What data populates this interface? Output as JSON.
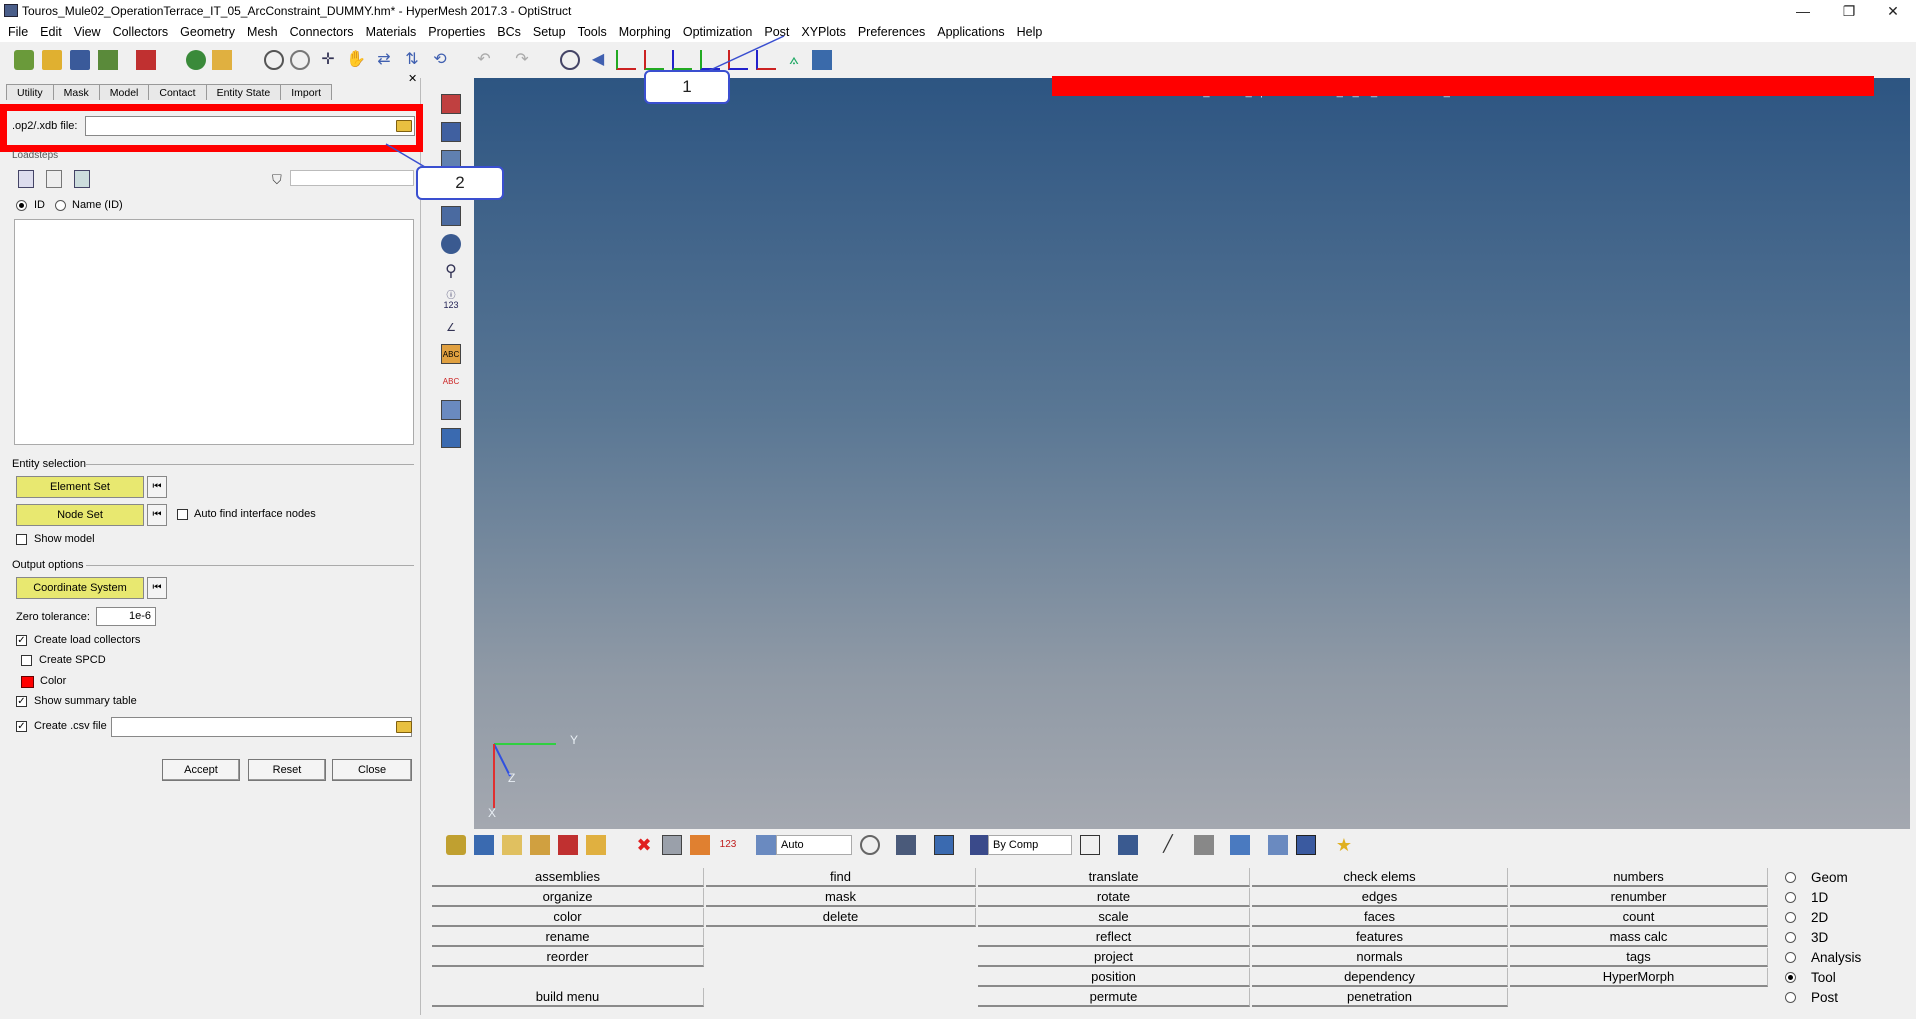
{
  "window": {
    "title": "Touros_Mule02_OperationTerrace_IT_05_ArcConstraint_DUMMY.hm* - HyperMesh 2017.3 - OptiStruct",
    "minimize": "—",
    "restore": "❐",
    "close": "✕"
  },
  "menu": [
    "File",
    "Edit",
    "View",
    "Collectors",
    "Geometry",
    "Mesh",
    "Connectors",
    "Materials",
    "Properties",
    "BCs",
    "Setup",
    "Tools",
    "Morphing",
    "Optimization",
    "Post",
    "XYPlots",
    "Preferences",
    "Applications",
    "Help"
  ],
  "left_panel": {
    "tabs": [
      "Utility",
      "Mask",
      "Model",
      "Contact",
      "Entity State",
      "Import"
    ],
    "file_label": ".op2/.xdb file:",
    "file_value": "",
    "filter_value": "",
    "loadsteps_label": "Loadsteps",
    "id_radio": "ID",
    "name_radio": "Name (ID)",
    "entity_selection_label": "Entity selection",
    "element_set_button": "Element Set",
    "node_set_button": "Node Set",
    "auto_find_label": "Auto find interface nodes",
    "show_model_label": "Show model",
    "output_options_label": "Output options",
    "coordinate_system_button": "Coordinate System",
    "zero_tolerance_label": "Zero tolerance:",
    "zero_tolerance_value": "1e-6",
    "create_load_collectors_label": "Create load collectors",
    "create_spcd_label": "Create SPCD",
    "color_label": "Color",
    "color_swatch": "#ff0000",
    "show_summary_label": "Show summary table",
    "create_csv_label": "Create .csv file",
    "csv_value": "",
    "accept_button": "Accept",
    "reset_button": "Reset",
    "close_button": "Close"
  },
  "viewport": {
    "path_text": "...model/HM/Touros/Touros_Mule02_OperationTerrace_IT_05_ArcConstraint_DUMMY.hm*",
    "axis_y": "Y",
    "axis_z": "Z",
    "axis_x": "X"
  },
  "callouts": {
    "one": "1",
    "two": "2"
  },
  "bottom_toolbar": {
    "display_mode": "Auto",
    "color_mode": "By Comp"
  },
  "commands": {
    "col1": [
      "assemblies",
      "organize",
      "color",
      "rename",
      "reorder",
      "",
      "build menu"
    ],
    "col2": [
      "find",
      "mask",
      "delete"
    ],
    "col3": [
      "translate",
      "rotate",
      "scale",
      "reflect",
      "project",
      "position",
      "permute"
    ],
    "col4": [
      "check elems",
      "edges",
      "faces",
      "features",
      "normals",
      "dependency",
      "penetration"
    ],
    "col5": [
      "numbers",
      "renumber",
      "count",
      "mass calc",
      "tags",
      "HyperMorph"
    ]
  },
  "page_types": [
    "Geom",
    "1D",
    "2D",
    "3D",
    "Analysis",
    "Tool",
    "Post"
  ],
  "page_type_selected": "Tool"
}
